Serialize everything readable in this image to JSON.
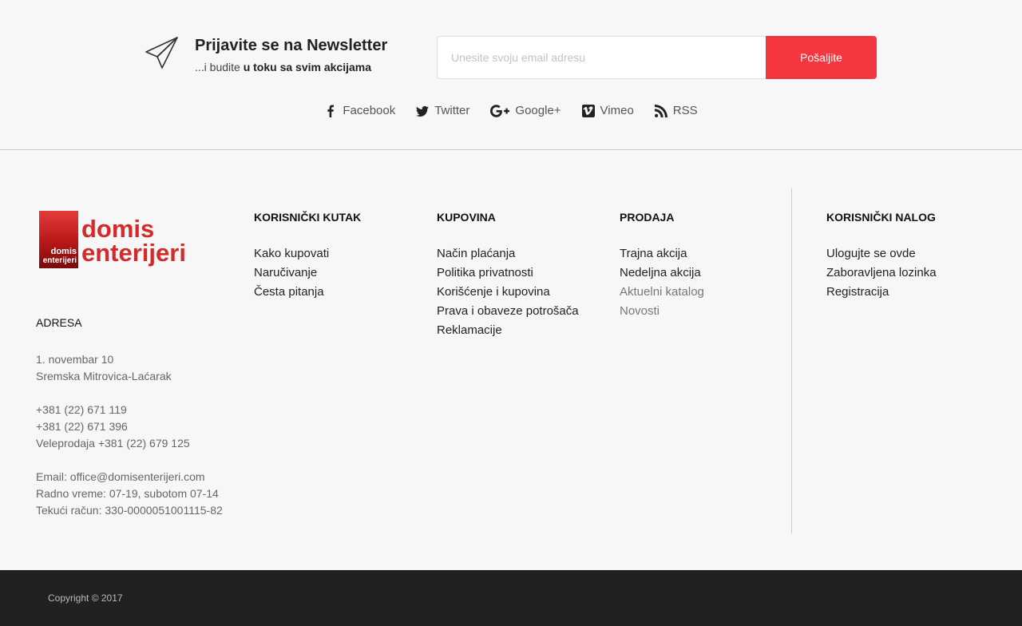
{
  "newsletter": {
    "title": "Prijavite se na Newsletter",
    "subtitle_prefix": "...i budite ",
    "subtitle_bold": "u toku sa svim akcijama",
    "email_placeholder": "Unesite svoju email adresu",
    "email_value": "",
    "submit_label": "Pošaljite",
    "accent_color": "#f3363f"
  },
  "social": [
    {
      "icon": "facebook-icon",
      "label": "Facebook"
    },
    {
      "icon": "twitter-icon",
      "label": "Twitter"
    },
    {
      "icon": "google-plus-icon",
      "label": "Google+"
    },
    {
      "icon": "vimeo-icon",
      "label": "Vimeo"
    },
    {
      "icon": "rss-icon",
      "label": "RSS"
    }
  ],
  "logo": {
    "square_line1": "domis",
    "square_line2": "enterijeri",
    "word1": "domis",
    "word2": "enterijeri"
  },
  "address": {
    "heading": "ADRESA",
    "street": "1. novembar 10",
    "city": "Sremska Mitrovica-Laćarak",
    "phone1": "+381 (22) 671 119",
    "phone2": "+381 (22) 671 396",
    "wholesale": "Veleprodaja +381 (22) 679 125",
    "email": "Email: office@domisenterijeri.com",
    "hours": "Radno vreme: 07-19, subotom 07-14",
    "account": "Tekući račun: 330-0000051001115-82"
  },
  "columns": {
    "korisnicki_kutak": {
      "heading": "KORISNIČKI KUTAK",
      "items": [
        "Kako kupovati",
        "Naručivanje",
        "Česta pitanja"
      ]
    },
    "kupovina": {
      "heading": "KUPOVINA",
      "items": [
        "Način plaćanja",
        "Politika privatnosti",
        "Korišćenje i kupovina",
        "Prava i obaveze potrošača",
        "Reklamacije"
      ]
    },
    "prodaja": {
      "heading": "PRODAJA",
      "items": [
        "Trajna akcija",
        "Nedeljna akcija",
        "Aktuelni katalog",
        "Novosti"
      ]
    },
    "korisnicki_nalog": {
      "heading": "KORISNIČKI NALOG",
      "items": [
        "Ulogujte se ovde",
        "Zaboravljena lozinka",
        "Registracija"
      ]
    }
  },
  "footer": {
    "copyright": "Copyright © 2017"
  }
}
